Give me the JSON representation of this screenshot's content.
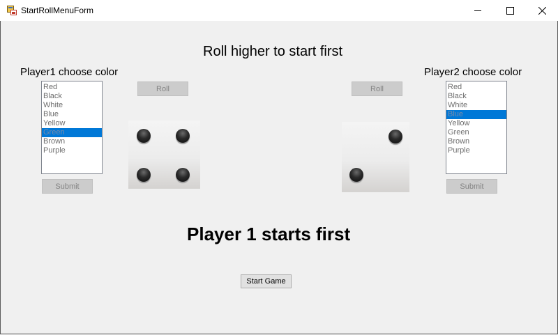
{
  "window": {
    "title": "StartRollMenuForm"
  },
  "header": {
    "instruction": "Roll higher to start first"
  },
  "player1": {
    "label": "Player1 choose color",
    "colors": [
      "Red",
      "Black",
      "White",
      "Blue",
      "Yellow",
      "Green",
      "Brown",
      "Purple"
    ],
    "selected": "Green",
    "roll_label": "Roll",
    "submit_label": "Submit",
    "die_value": 4
  },
  "player2": {
    "label": "Player2 choose color",
    "colors": [
      "Red",
      "Black",
      "White",
      "Blue",
      "Yellow",
      "Green",
      "Brown",
      "Purple"
    ],
    "selected": "Blue",
    "roll_label": "Roll",
    "submit_label": "Submit",
    "die_value": 2
  },
  "result": {
    "text": "Player 1 starts first"
  },
  "start_button": {
    "label": "Start Game"
  },
  "colors": {
    "selection": "#0078d7",
    "background": "#f0f0f0"
  }
}
